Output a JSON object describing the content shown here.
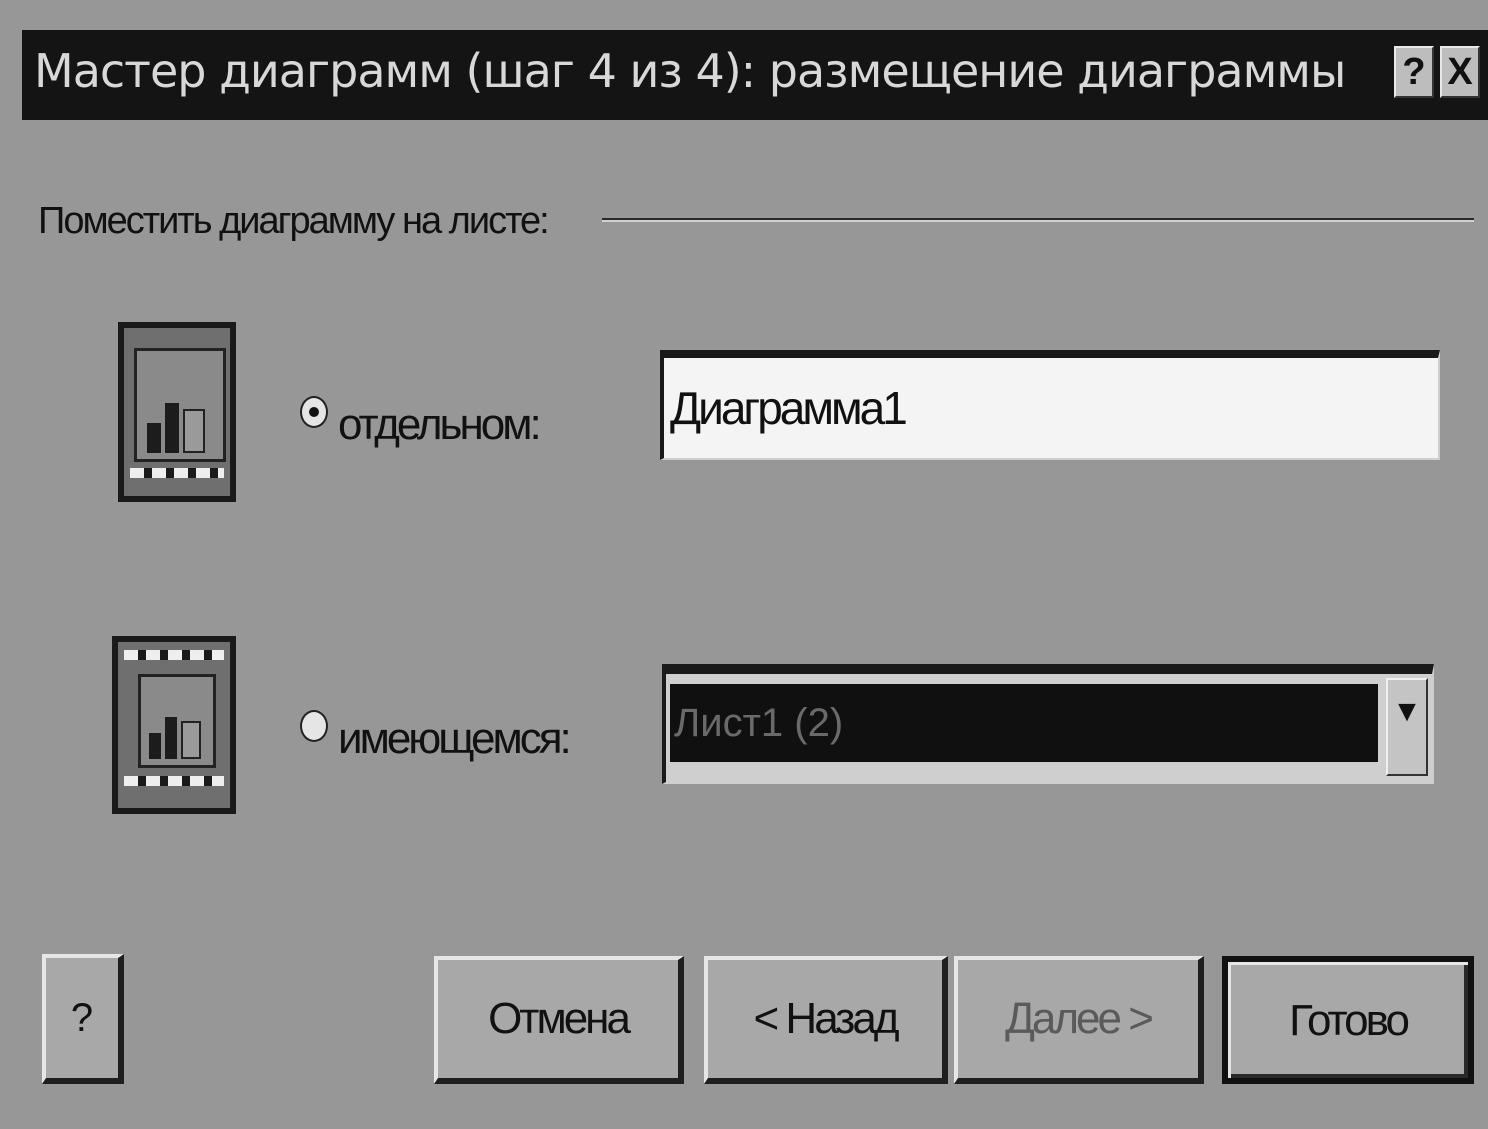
{
  "dialog": {
    "title": "Мастер диаграмм (шаг 4 из 4): размещение диаграммы",
    "help_glyph": "?",
    "close_glyph": "X"
  },
  "placement": {
    "group_label": "Поместить диаграмму на листе:",
    "option_new_label": "отдельном:",
    "option_new_selected": true,
    "option_new_value": "Диаграмма1",
    "option_embed_label": "имеющемся:",
    "option_embed_selected": false,
    "option_embed_value": "Лист1 (2)",
    "dropdown_glyph": "▼"
  },
  "buttons": {
    "help": "?",
    "cancel": "Отмена",
    "back": "< Назад",
    "next": "Далее >",
    "finish": "Готово"
  },
  "icons": {
    "new_sheet": "new-sheet-chart-icon",
    "embedded": "embedded-chart-icon"
  }
}
